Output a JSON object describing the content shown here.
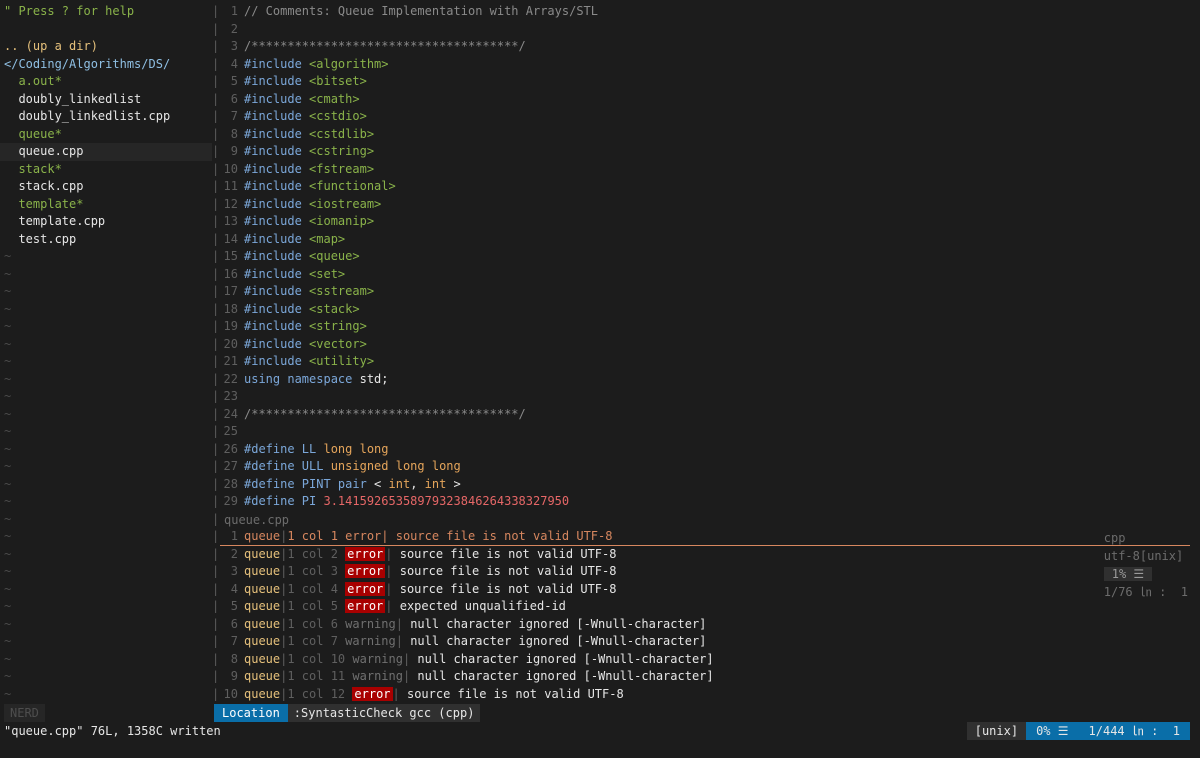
{
  "tree": {
    "help": "\" Press ? for help",
    "up": ".. (up a dir)",
    "path": "</Coding/Algorithms/DS/",
    "files": [
      {
        "name": "a.out*",
        "exec": true
      },
      {
        "name": "doubly_linkedlist",
        "exec": false
      },
      {
        "name": "doubly_linkedlist.cpp",
        "exec": false
      },
      {
        "name": "queue*",
        "exec": true
      },
      {
        "name": "queue.cpp",
        "exec": false,
        "selected": true
      },
      {
        "name": "stack*",
        "exec": true
      },
      {
        "name": "stack.cpp",
        "exec": false
      },
      {
        "name": "template*",
        "exec": true
      },
      {
        "name": "template.cpp",
        "exec": false
      },
      {
        "name": "test.cpp",
        "exec": false
      }
    ],
    "tilde": "~",
    "tilde_count": 26,
    "label": "NERD"
  },
  "editor": {
    "lines": [
      {
        "n": "1",
        "t": [
          [
            "cmt",
            "// Comments: Queue Implementation with Arrays/STL"
          ]
        ]
      },
      {
        "n": "2",
        "t": []
      },
      {
        "n": "3",
        "t": [
          [
            "cmt",
            "/*************************************/"
          ]
        ]
      },
      {
        "n": "4",
        "t": [
          [
            "kw",
            "#include "
          ],
          [
            "str",
            "<algorithm>"
          ]
        ]
      },
      {
        "n": "5",
        "t": [
          [
            "kw",
            "#include "
          ],
          [
            "str",
            "<bitset>"
          ]
        ]
      },
      {
        "n": "6",
        "t": [
          [
            "kw",
            "#include "
          ],
          [
            "str",
            "<cmath>"
          ]
        ]
      },
      {
        "n": "7",
        "t": [
          [
            "kw",
            "#include "
          ],
          [
            "str",
            "<cstdio>"
          ]
        ]
      },
      {
        "n": "8",
        "t": [
          [
            "kw",
            "#include "
          ],
          [
            "str",
            "<cstdlib>"
          ]
        ]
      },
      {
        "n": "9",
        "t": [
          [
            "kw",
            "#include "
          ],
          [
            "str",
            "<cstring>"
          ]
        ]
      },
      {
        "n": "10",
        "t": [
          [
            "kw",
            "#include "
          ],
          [
            "str",
            "<fstream>"
          ]
        ]
      },
      {
        "n": "11",
        "t": [
          [
            "kw",
            "#include "
          ],
          [
            "str",
            "<functional>"
          ]
        ]
      },
      {
        "n": "12",
        "t": [
          [
            "kw",
            "#include "
          ],
          [
            "str",
            "<iostream>"
          ]
        ]
      },
      {
        "n": "13",
        "t": [
          [
            "kw",
            "#include "
          ],
          [
            "str",
            "<iomanip>"
          ]
        ]
      },
      {
        "n": "14",
        "t": [
          [
            "kw",
            "#include "
          ],
          [
            "str",
            "<map>"
          ]
        ]
      },
      {
        "n": "15",
        "t": [
          [
            "kw",
            "#include "
          ],
          [
            "str",
            "<queue>"
          ]
        ]
      },
      {
        "n": "16",
        "t": [
          [
            "kw",
            "#include "
          ],
          [
            "str",
            "<set>"
          ]
        ]
      },
      {
        "n": "17",
        "t": [
          [
            "kw",
            "#include "
          ],
          [
            "str",
            "<sstream>"
          ]
        ]
      },
      {
        "n": "18",
        "t": [
          [
            "kw",
            "#include "
          ],
          [
            "str",
            "<stack>"
          ]
        ]
      },
      {
        "n": "19",
        "t": [
          [
            "kw",
            "#include "
          ],
          [
            "str",
            "<string>"
          ]
        ]
      },
      {
        "n": "20",
        "t": [
          [
            "kw",
            "#include "
          ],
          [
            "str",
            "<vector>"
          ]
        ]
      },
      {
        "n": "21",
        "t": [
          [
            "kw",
            "#include "
          ],
          [
            "str",
            "<utility>"
          ]
        ]
      },
      {
        "n": "22",
        "t": [
          [
            "kw",
            "using namespace "
          ],
          [
            "plain",
            "std;"
          ]
        ]
      },
      {
        "n": "23",
        "t": []
      },
      {
        "n": "24",
        "t": [
          [
            "cmt",
            "/*************************************/"
          ]
        ]
      },
      {
        "n": "25",
        "t": []
      },
      {
        "n": "26",
        "t": [
          [
            "kw",
            "#define "
          ],
          [
            "kw",
            "LL "
          ],
          [
            "type",
            "long long"
          ]
        ]
      },
      {
        "n": "27",
        "t": [
          [
            "kw",
            "#define "
          ],
          [
            "kw",
            "ULL "
          ],
          [
            "type",
            "unsigned long long"
          ]
        ]
      },
      {
        "n": "28",
        "t": [
          [
            "kw",
            "#define "
          ],
          [
            "kw",
            "PINT "
          ],
          [
            "kw",
            "pair "
          ],
          [
            "plain",
            "< "
          ],
          [
            "type",
            "int"
          ],
          [
            "plain",
            ", "
          ],
          [
            "type",
            "int"
          ],
          [
            "plain",
            " >"
          ]
        ]
      },
      {
        "n": "29",
        "t": [
          [
            "kw",
            "#define "
          ],
          [
            "kw",
            "PI "
          ],
          [
            "num",
            "3.14159265358979323846264338327950"
          ]
        ]
      }
    ]
  },
  "editor_status": {
    "filename": "queue.cpp",
    "filetype": "cpp",
    "encoding": "utf-8[unix]",
    "percent": "1% ☰",
    "position": "1/76 ㏑ :  1"
  },
  "loclist": {
    "items": [
      {
        "n": "1",
        "file": "queue",
        "loc": "1 col 1",
        "kind": "error",
        "msg": "source file is not valid UTF-8",
        "current": true
      },
      {
        "n": "2",
        "file": "queue",
        "loc": "1 col 2",
        "kind": "error",
        "msg": "source file is not valid UTF-8"
      },
      {
        "n": "3",
        "file": "queue",
        "loc": "1 col 3",
        "kind": "error",
        "msg": "source file is not valid UTF-8"
      },
      {
        "n": "4",
        "file": "queue",
        "loc": "1 col 4",
        "kind": "error",
        "msg": "source file is not valid UTF-8"
      },
      {
        "n": "5",
        "file": "queue",
        "loc": "1 col 5",
        "kind": "error",
        "msg": "expected unqualified-id"
      },
      {
        "n": "6",
        "file": "queue",
        "loc": "1 col 6",
        "kind": "warning",
        "msg": "null character ignored [-Wnull-character]"
      },
      {
        "n": "7",
        "file": "queue",
        "loc": "1 col 7",
        "kind": "warning",
        "msg": "null character ignored [-Wnull-character]"
      },
      {
        "n": "8",
        "file": "queue",
        "loc": "1 col 10",
        "kind": "warning",
        "msg": "null character ignored [-Wnull-character]"
      },
      {
        "n": "9",
        "file": "queue",
        "loc": "1 col 11",
        "kind": "warning",
        "msg": "null character ignored [-Wnull-character]"
      },
      {
        "n": "10",
        "file": "queue",
        "loc": "1 col 12",
        "kind": "error",
        "msg": "source file is not valid UTF-8"
      }
    ]
  },
  "loclist_status": {
    "tab": "Location",
    "command": ":SyntasticCheck gcc (cpp)",
    "format": "[unix]",
    "percent": "0% ☰",
    "position": "1/444 ㏑ :  1"
  },
  "cmdline": "\"queue.cpp\" 76L, 1358C written"
}
